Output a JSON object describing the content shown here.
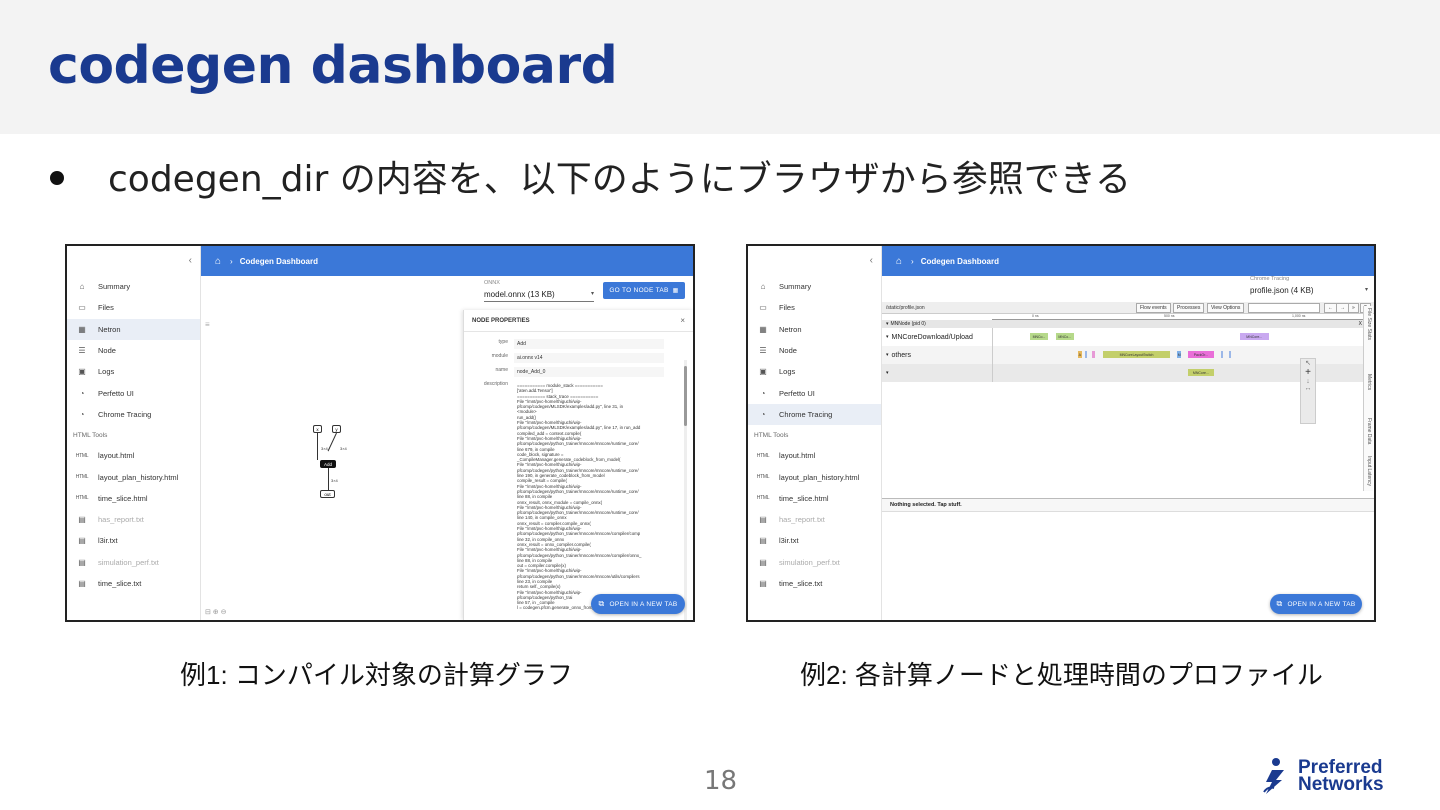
{
  "slide": {
    "title": "codegen dashboard",
    "bullet": "codegen_dir の内容を、以下のようにブラウザから参照できる",
    "caption1": "例1: コンパイル対象の計算グラフ",
    "caption2": "例2: 各計算ノードと処理時間のプロファイル",
    "page_number": "18",
    "logo_line1": "Preferred",
    "logo_line2": "Networks",
    "colors": {
      "title": "#1a3a8f",
      "accent": "#3b78d8",
      "band": "#f3f3f3"
    }
  },
  "dashboard": {
    "collapse_glyph": "‹",
    "breadcrumb": "Codegen Dashboard",
    "nav": [
      {
        "label": "Summary",
        "icon": "home-icon"
      },
      {
        "label": "Files",
        "icon": "folder-icon"
      },
      {
        "label": "Netron",
        "icon": "netron-icon"
      },
      {
        "label": "Node",
        "icon": "list-icon"
      },
      {
        "label": "Logs",
        "icon": "terminal-icon"
      },
      {
        "label": "Perfetto UI",
        "icon": "gauge-icon"
      },
      {
        "label": "Chrome Tracing",
        "icon": "gauge-icon"
      }
    ],
    "group": "HTML Tools",
    "tools": [
      {
        "label": "layout.html",
        "icon": "html-file-icon"
      },
      {
        "label": "layout_plan_history.html",
        "icon": "html-file-icon"
      },
      {
        "label": "time_slice.html",
        "icon": "html-file-icon"
      },
      {
        "label": "has_report.txt",
        "icon": "text-file-icon"
      },
      {
        "label": "l3ir.txt",
        "icon": "text-file-icon"
      },
      {
        "label": "simulation_perf.txt",
        "icon": "text-file-icon"
      },
      {
        "label": "time_slice.txt",
        "icon": "text-file-icon"
      }
    ],
    "open_new_tab": "OPEN IN A NEW TAB"
  },
  "netron_view": {
    "select_label": "ONNX",
    "select_value": "model.onnx (13 KB)",
    "go_button": "GO TO NODE TAB",
    "menu_glyph": "≡",
    "graph": {
      "input_x": "x",
      "input_y": "y",
      "shape_x": "3×4",
      "shape_y": "3×4",
      "op": "Add",
      "shape_out": "3×4",
      "output": "out"
    },
    "panel_title": "NODE PROPERTIES",
    "close_glyph": "×",
    "props": [
      {
        "key": "type",
        "value": "Add"
      },
      {
        "key": "module",
        "value": "ai.onnx v14"
      },
      {
        "key": "name",
        "value": "node_Add_0"
      }
    ],
    "desc_key": "description",
    "description": "=========== module_stack ===========\n['aten.add.Tensor']\n=========== stack_trace ===========\nFile \"/mnt/pvc-home/thiguchi/wip-\npfcomp/codegen/MLSDK/examples/add.py\", line 31, in\n<module>\nrun_add()\nFile \"/mnt/pvc-home/thiguchi/wip-\npfcomp/codegen/MLSDK/examples/add.py\", line 17, in run_add\ncompiled_add = context.compile(\nFile \"/mnt/pvc-home/thiguchi/wip-\npfcomp/codegen/python_trainer/mncore/mncore/runtime_core/\nline 679, in compile\ncode_block, signature =\n_CompileManager.generate_codeblock_from_model(\nFile \"/mnt/pvc-home/thiguchi/wip-\npfcomp/codegen/python_trainer/mncore/mncore/runtime_core/\nline 190, in generate_codeblock_from_model\ncompile_result = compile(\nFile \"/mnt/pvc-home/thiguchi/wip-\npfcomp/codegen/python_trainer/mncore/mncore/runtime_core/\nline 88, in compile\nonnx_result, onnx_module = compile_onnx(\nFile \"/mnt/pvc-home/thiguchi/wip-\npfcomp/codegen/python_trainer/mncore/mncore/runtime_core/\nline 140, in compile_onnx\nonnx_result = compiler.compile_onnx(\nFile \"/mnt/pvc-home/thiguchi/wip-\npfcomp/codegen/python_trainer/mncore/mncore/compiler/comp\nline 32, in compile_onnx\nonnx_result = onnx_compiler.compile(\nFile \"/mnt/pvc-home/thiguchi/wip-\npfcomp/codegen/python_trainer/mncore/mncore/compiler/onnx_\nline 88, in compile\nout = compiler.compile(x)\nFile \"/mnt/pvc-home/thiguchi/wip-\npfcomp/codegen/python_trainer/mncore/mncore/utils/compilers\nline 23, in compile\nreturn self._compile(x)\nFile \"/mnt/pvc-home/thiguchi/wip-\npfcomp/codegen/python_trai\nline 57, in _compile\nl = codegen.pfcm.generate_onnx_from_pytorch(",
    "zoom_icons": "⊟ ⊕ ⊖"
  },
  "tracing_view": {
    "select_label": "Chrome Tracing",
    "select_value": "profile.json (4 KB)",
    "path": "/static/profile.json",
    "buttons": [
      "Flow events",
      "Processes",
      "View Options"
    ],
    "nav_glyphs": [
      "←",
      "→",
      "»",
      "?"
    ],
    "ruler": [
      "0 ns",
      "500 ns",
      "1,000 ns"
    ],
    "process": "MNNode (pid 0)",
    "process_close": "X",
    "tracks": [
      {
        "label": "MNCoreDownload/Upload"
      },
      {
        "label": "others"
      },
      {
        "label": ""
      }
    ],
    "slices": [
      {
        "track": 0,
        "start": 0.1,
        "width": 0.05,
        "color": "#b6d98a",
        "text": "MNCo..."
      },
      {
        "track": 0,
        "start": 0.17,
        "width": 0.05,
        "color": "#b6d98a",
        "text": "MNCo..."
      },
      {
        "track": 0,
        "start": 0.67,
        "width": 0.08,
        "color": "#c9a9f0",
        "text": "MNCore..."
      },
      {
        "track": 1,
        "start": 0.23,
        "width": 0.012,
        "color": "#e6b85c",
        "text": "A"
      },
      {
        "track": 1,
        "start": 0.25,
        "width": 0.006,
        "color": "#9cb8e8",
        "text": ""
      },
      {
        "track": 1,
        "start": 0.27,
        "width": 0.006,
        "color": "#e79ad6",
        "text": ""
      },
      {
        "track": 1,
        "start": 0.3,
        "width": 0.18,
        "color": "#c3cf6a",
        "text": "MNCoreLayoutSwitch"
      },
      {
        "track": 1,
        "start": 0.5,
        "width": 0.012,
        "color": "#7fb0e8",
        "text": "M"
      },
      {
        "track": 1,
        "start": 0.53,
        "width": 0.07,
        "color": "#e96ed8",
        "text": "PackOr..."
      },
      {
        "track": 1,
        "start": 0.62,
        "width": 0.006,
        "color": "#9cb8e8",
        "text": ""
      },
      {
        "track": 1,
        "start": 0.64,
        "width": 0.006,
        "color": "#9cb8e8",
        "text": ""
      },
      {
        "track": 2,
        "start": 0.53,
        "width": 0.07,
        "color": "#c3cf6a",
        "text": "MNCore..."
      }
    ],
    "side_tabs": [
      "File Size Stats",
      "Metrics",
      "Frame Data",
      "Input Latency"
    ],
    "tool_glyphs": [
      "↖",
      "+",
      "↓",
      "↔"
    ],
    "details": "Nothing selected. Tap stuff."
  }
}
